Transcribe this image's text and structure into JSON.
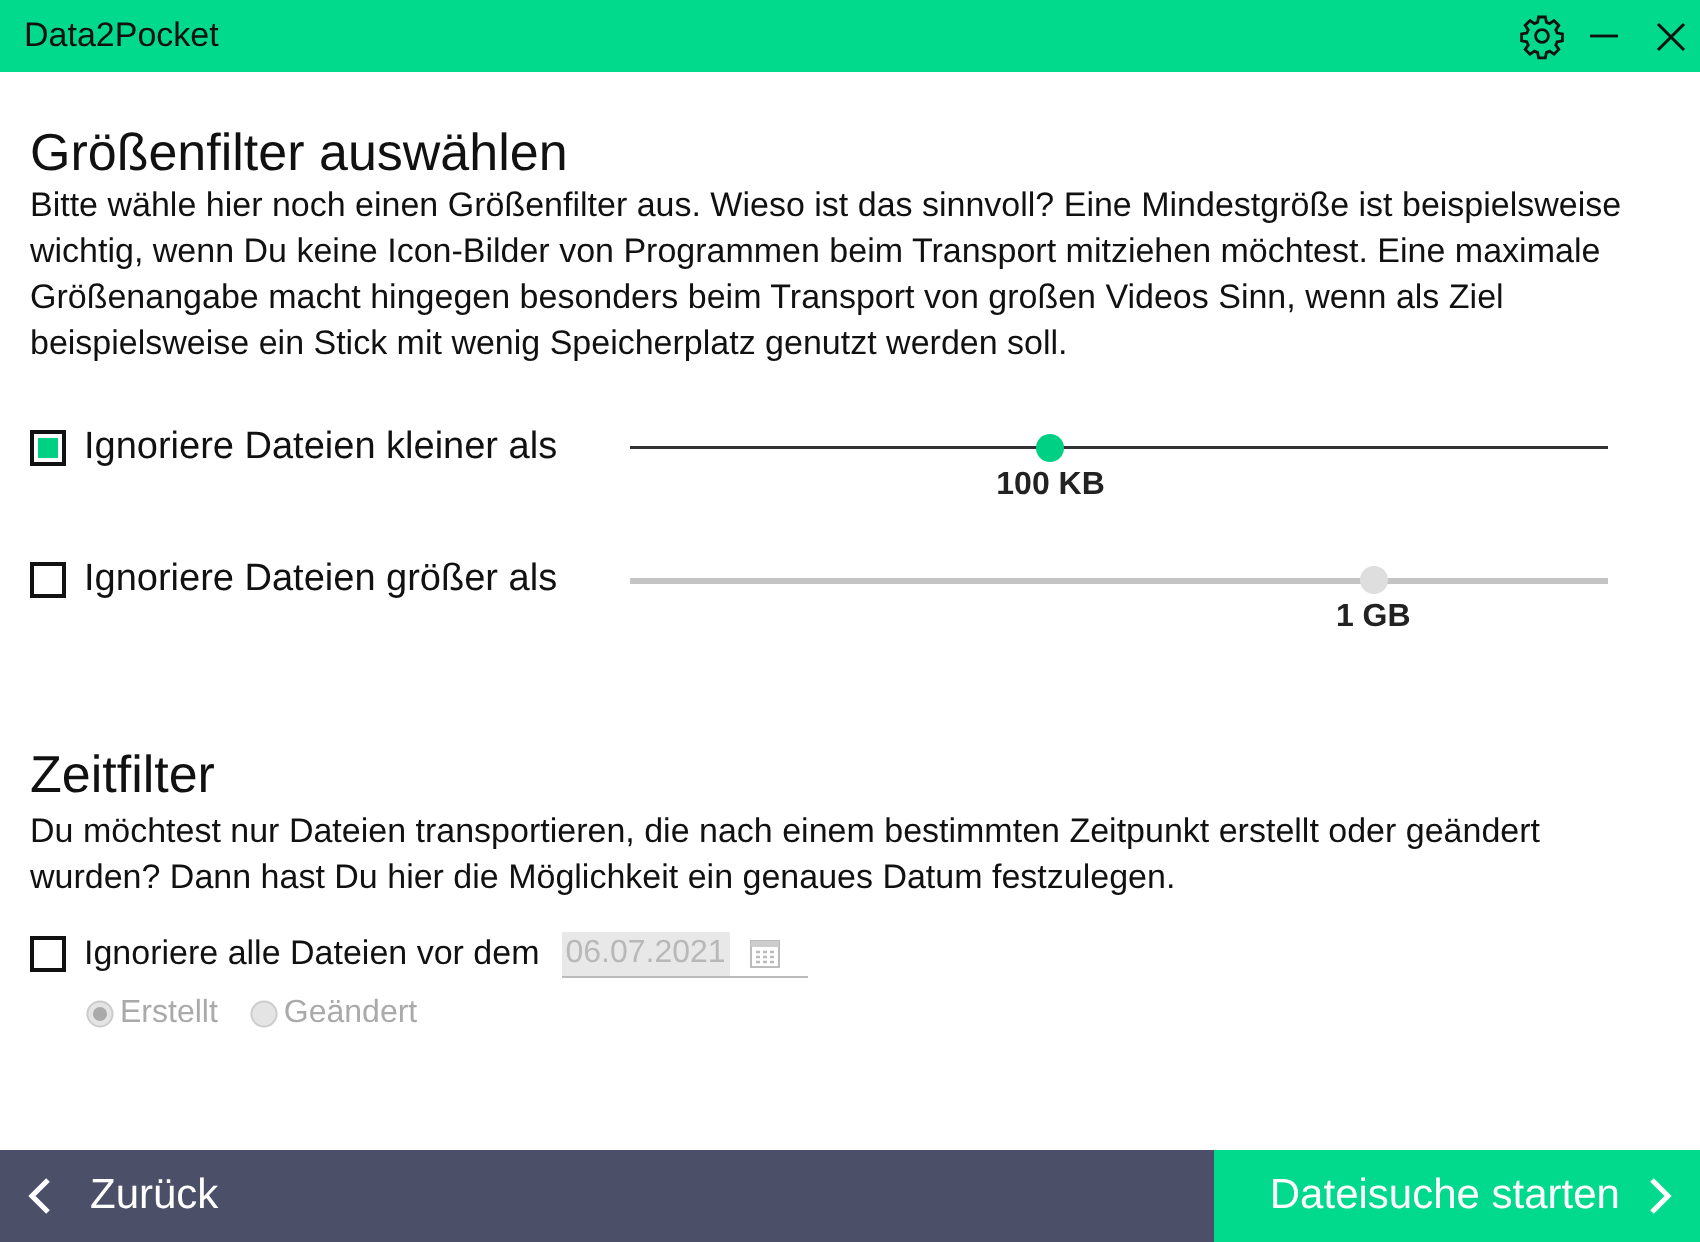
{
  "window": {
    "title": "Data2Pocket"
  },
  "size_filter": {
    "heading": "Größenfilter auswählen",
    "description": "Bitte wähle hier noch einen Größenfilter aus. Wieso ist das sinnvoll? Eine Mindestgröße ist beispielsweise wichtig, wenn Du keine Icon-Bilder von Programmen beim Transport mitziehen möchtest. Eine maximale Größenangabe macht hingegen besonders beim Transport von großen Videos Sinn, wenn als Ziel beispielsweise ein Stick mit wenig Speicherplatz genutzt werden soll.",
    "rules": [
      {
        "label": "Ignoriere Dateien kleiner als",
        "checked": true,
        "level": 0.43,
        "reading": "100 KB"
      },
      {
        "label": "Ignoriere Dateien größer als",
        "checked": false,
        "level": 0.76,
        "reading": "1 GB"
      }
    ]
  },
  "time_filter": {
    "heading": "Zeitfilter",
    "description": "Du möchtest nur Dateien transportieren, die nach einem bestimmten Zeitpunkt erstellt oder geändert wurden? Dann hast Du hier die Möglichkeit ein genaues Datum festzulegen.",
    "rule": {
      "label": "Ignoriere alle Dateien vor dem",
      "checked": false,
      "date_value": "06.07.2021"
    },
    "date_options": [
      {
        "label": "Erstellt",
        "selected": true
      },
      {
        "label": "Geändert",
        "selected": false
      }
    ]
  },
  "footer": {
    "back_button": "Zurück",
    "next_button": "Dateisuche starten"
  }
}
